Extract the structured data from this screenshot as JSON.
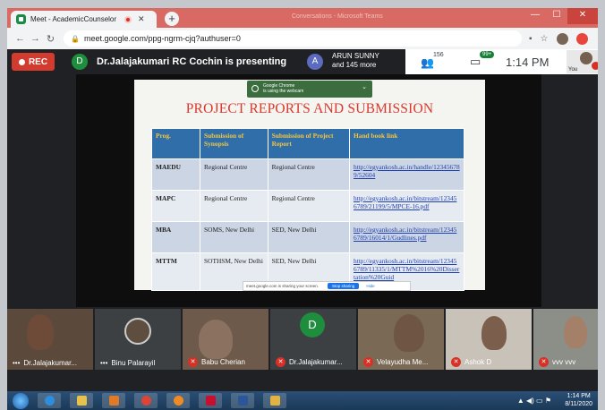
{
  "browser": {
    "tab_title": "Meet - AcademicCounselor",
    "tab_close": "✕",
    "new_tab": "+",
    "faded_title": "Conversations - Microsoft Teams",
    "url": "meet.google.com/ppg-ngrm-cjq?authuser=0",
    "win_min": "—",
    "win_max": "☐",
    "win_close": "✕"
  },
  "meet": {
    "rec_label": "REC",
    "presenter_initial": "D",
    "presenting_text": "Dr.Jalajakumari RC Cochin is presenting",
    "people_initial": "A",
    "people_line1": "ARUN SUNNY",
    "people_line2": "and 145 more",
    "participant_count": "156",
    "chat_badge": "99+",
    "time": "1:14 PM",
    "you_label": "You"
  },
  "slide": {
    "chrome_note_line1": "Google Chrome",
    "chrome_note_line2": "is using the webcam",
    "title": "PROJECT REPORTS AND SUBMISSION",
    "headers": [
      "Prog.",
      "Submission of Synopsis",
      "Submission of Project Report",
      "Hand book link"
    ],
    "rows": [
      {
        "prog": "MAEDU",
        "synopsis": "Regional Centre",
        "report": "Regional Centre",
        "link": "http://egyankosh.ac.in/handle/123456789/52604"
      },
      {
        "prog": "MAPC",
        "synopsis": "Regional Centre",
        "report": "Regional Centre",
        "link": "http://egyankosh.ac.in/bitstream/123456789/21199/5/MPCE-16.pdf"
      },
      {
        "prog": "MBA",
        "synopsis": "SOMS, New Delhi",
        "report": "SED, New Delhi",
        "link": "http://egyankosh.ac.in/bitstream/123456789/16014/1/Gudlines.pdf"
      },
      {
        "prog": "MTTM",
        "synopsis": "SOTHSM, New Delhi",
        "report": "SED, New Delhi",
        "link": "http://egyankosh.ac.in/bitstream/123456789/11335/1/MTTM%2016%20Dissertation%20Guid"
      }
    ],
    "share_text": "meet.google.com is sharing your screen.",
    "stop_sharing": "Stop sharing",
    "hide": "Hide"
  },
  "tiles": [
    {
      "name": "Dr.Jalajakumar..."
    },
    {
      "name": "Binu Palarayil"
    },
    {
      "name": "Babu Cherian"
    },
    {
      "name": "Dr.Jalajakumar...",
      "initial": "D"
    },
    {
      "name": "Velayudha Me..."
    },
    {
      "name": "Ashok D"
    },
    {
      "name": "vvv vvv"
    }
  ],
  "taskbar": {
    "time": "1:14 PM",
    "date": "8/11/2020"
  }
}
